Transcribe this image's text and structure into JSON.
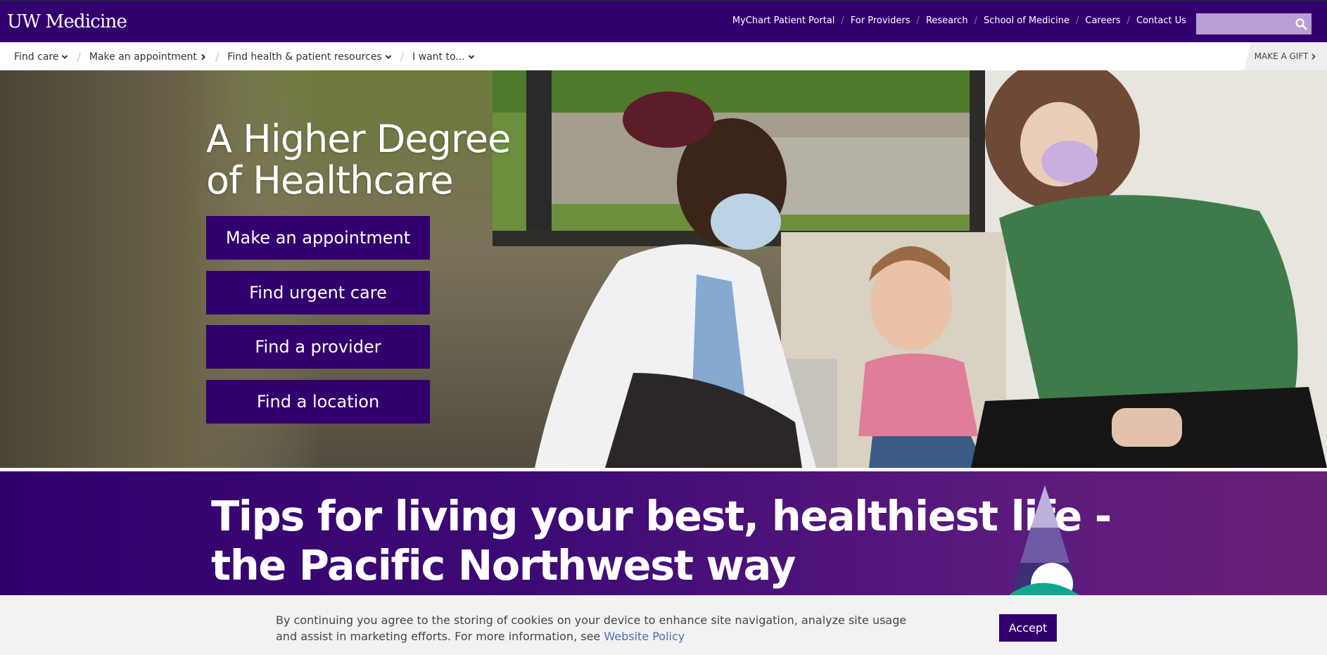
{
  "header": {
    "logo": "UW Medicine",
    "links": [
      {
        "label": "MyChart Patient Portal"
      },
      {
        "label": "For Providers"
      },
      {
        "label": "Research"
      },
      {
        "label": "School of Medicine"
      },
      {
        "label": "Careers"
      },
      {
        "label": "Contact Us"
      }
    ],
    "search": {
      "value": "",
      "placeholder": "",
      "icon": "search-icon"
    }
  },
  "subnav": {
    "items": [
      {
        "label": "Find care",
        "icon": "chevron-down-icon"
      },
      {
        "label": "Make an appointment",
        "icon": "chevron-right-icon"
      },
      {
        "label": "Find health & patient resources",
        "icon": "chevron-down-icon"
      },
      {
        "label": "I want to...",
        "icon": "chevron-down-icon"
      }
    ],
    "gift_label": "MAKE A GIFT"
  },
  "hero": {
    "title": "A Higher Degree\nof Healthcare",
    "buttons": [
      {
        "label": "Make an appointment"
      },
      {
        "label": "Find urgent care"
      },
      {
        "label": "Find a provider"
      },
      {
        "label": "Find a location"
      }
    ]
  },
  "tips": {
    "title": "Tips for living your best, healthiest life -\nthe Pacific Northwest way"
  },
  "cookie": {
    "text": "By continuing you agree to the storing of cookies on your device to enhance site navigation, analyze site usage and assist in marketing efforts. For more information, see ",
    "link": "Website Policy",
    "accept_label": "Accept"
  },
  "colors": {
    "brand_purple": "#32006e",
    "search_bg": "#b79fd4",
    "link_blue": "#4d6db3"
  }
}
